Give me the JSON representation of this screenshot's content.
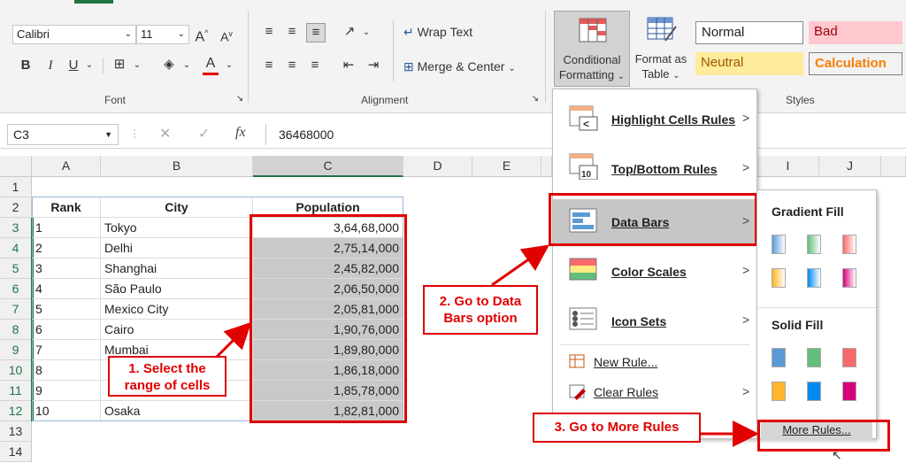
{
  "ribbon": {
    "font_name": "Calibri",
    "font_size": "11",
    "grow_font": "A",
    "shrink_font": "A",
    "bold": "B",
    "italic": "I",
    "underline": "U",
    "font_color": "A",
    "wrap_text": "Wrap Text",
    "merge_center": "Merge & Center",
    "group_font": "Font",
    "group_alignment": "Alignment",
    "group_styles": "Styles",
    "conditional_formatting_line1": "Conditional",
    "conditional_formatting_line2": "Formatting",
    "format_as_table_line1": "Format as",
    "format_as_table_line2": "Table",
    "styles": {
      "normal": "Normal",
      "bad": "Bad",
      "neutral": "Neutral",
      "calculation": "Calculation"
    }
  },
  "formula_bar": {
    "name_box": "C3",
    "fx": "fx",
    "value": "36468000"
  },
  "columns": [
    "A",
    "B",
    "C",
    "D",
    "E",
    "I",
    "J"
  ],
  "rows": [
    "1",
    "2",
    "3",
    "4",
    "5",
    "6",
    "7",
    "8",
    "9",
    "10",
    "11",
    "12",
    "13",
    "14"
  ],
  "headers": {
    "rank": "Rank",
    "city": "City",
    "population": "Population"
  },
  "data_rows": [
    {
      "rank": "1",
      "city": "Tokyo",
      "population": "3,64,68,000"
    },
    {
      "rank": "2",
      "city": "Delhi",
      "population": "2,75,14,000"
    },
    {
      "rank": "3",
      "city": "Shanghai",
      "population": "2,45,82,000"
    },
    {
      "rank": "4",
      "city": "São Paulo",
      "population": "2,06,50,000"
    },
    {
      "rank": "5",
      "city": "Mexico City",
      "population": "2,05,81,000"
    },
    {
      "rank": "6",
      "city": "Cairo",
      "population": "1,90,76,000"
    },
    {
      "rank": "7",
      "city": "Mumbai",
      "population": "1,89,80,000"
    },
    {
      "rank": "8",
      "city": "",
      "population": "1,86,18,000"
    },
    {
      "rank": "9",
      "city": "",
      "population": "1,85,78,000"
    },
    {
      "rank": "10",
      "city": "Osaka",
      "population": "1,82,81,000"
    }
  ],
  "menu": {
    "highlight": "Highlight Cells Rules",
    "topbottom": "Top/Bottom Rules",
    "databars": "Data Bars",
    "colorscales": "Color Scales",
    "iconsets": "Icon Sets",
    "newrule": "New Rule...",
    "clearrules": "Clear Rules",
    "managerules": ""
  },
  "submenu": {
    "gradient": "Gradient Fill",
    "solid": "Solid Fill",
    "more_rules": "More Rules..."
  },
  "callouts": {
    "c1_line1": "1. Select the",
    "c1_line2": "range of cells",
    "c2_line1": "2. Go to Data",
    "c2_line2": "Bars option",
    "c3": "3. Go to More Rules"
  },
  "colors": {
    "annotation": "#e00000",
    "selected_range": "#c9c9c9",
    "bad_fill": "#ffc7ce",
    "neutral_fill": "#ffeb9c"
  }
}
